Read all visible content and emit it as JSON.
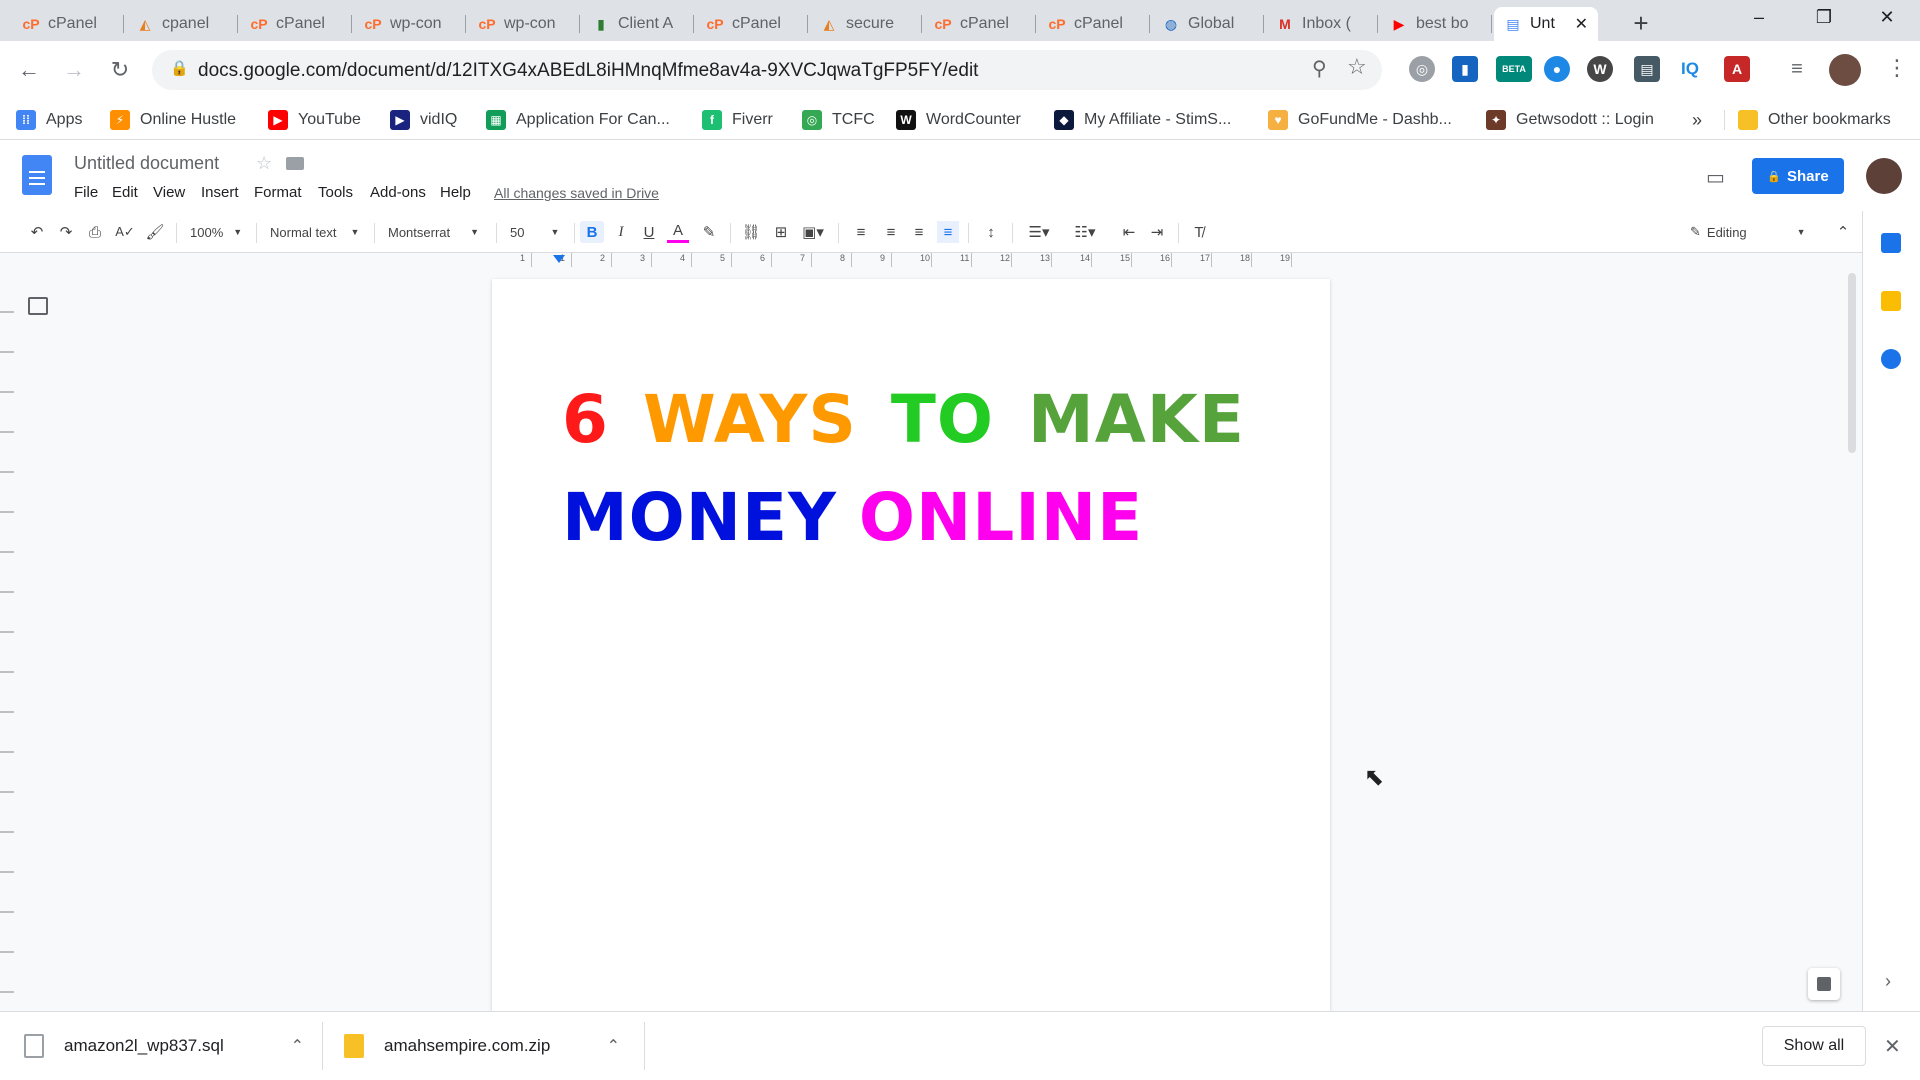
{
  "browser": {
    "tabs": [
      {
        "label": "cPanel",
        "icon": "cpanel-icon"
      },
      {
        "label": "cpanel",
        "icon": "hosting-icon"
      },
      {
        "label": "cPanel",
        "icon": "cpanel-icon"
      },
      {
        "label": "wp-con",
        "icon": "cpanel-icon"
      },
      {
        "label": "wp-con",
        "icon": "cpanel-icon"
      },
      {
        "label": "Client A",
        "icon": "chart-icon"
      },
      {
        "label": "cPanel",
        "icon": "cpanel-icon"
      },
      {
        "label": "secure",
        "icon": "hosting-icon"
      },
      {
        "label": "cPanel",
        "icon": "cpanel-icon"
      },
      {
        "label": "cPanel",
        "icon": "cpanel-icon"
      },
      {
        "label": "Global",
        "icon": "globe-icon"
      },
      {
        "label": "Inbox (",
        "icon": "gmail-icon"
      },
      {
        "label": "best bo",
        "icon": "youtube-icon"
      },
      {
        "label": "Unt",
        "icon": "docs-icon",
        "active": true
      }
    ],
    "url": "docs.google.com/document/d/12ITXG4xABEdL8iHMnqMfme8av4a-9XVCJqwaTgFP5FY/edit",
    "beta_badge": "BETA",
    "iq_badge": "IQ"
  },
  "bookmarks": [
    {
      "label": "Apps",
      "icon": "apps-grid-icon",
      "color": "#4285f4"
    },
    {
      "label": "Online Hustle",
      "icon": "hustle-icon",
      "color": "#ff8f00"
    },
    {
      "label": "YouTube",
      "icon": "youtube-icon",
      "color": "#ff0000"
    },
    {
      "label": "vidIQ",
      "icon": "vidiq-icon",
      "color": "#1a237e"
    },
    {
      "label": "Application For Can...",
      "icon": "sheets-icon",
      "color": "#0f9d58"
    },
    {
      "label": "Fiverr",
      "icon": "fiverr-icon",
      "color": "#1dbf73"
    },
    {
      "label": "TCFC",
      "icon": "tcfc-icon",
      "color": "#34a853"
    },
    {
      "label": "WordCounter",
      "icon": "wordcounter-icon",
      "color": "#111111"
    },
    {
      "label": "My Affiliate - StimS...",
      "icon": "affiliate-icon",
      "color": "#0b1a3c"
    },
    {
      "label": "GoFundMe - Dashb...",
      "icon": "gofundme-icon",
      "color": "#f5b041"
    },
    {
      "label": "Getwsodott :: Login",
      "icon": "login-icon",
      "color": "#6d3a2a"
    }
  ],
  "bookmarks_overflow": "»",
  "other_bookmarks": "Other bookmarks",
  "docs": {
    "title": "Untitled document",
    "menu": [
      "File",
      "Edit",
      "View",
      "Insert",
      "Format",
      "Tools",
      "Add-ons",
      "Help"
    ],
    "save_status": "All changes saved in Drive",
    "share_label": "Share",
    "zoom": "100%",
    "style": "Normal text",
    "font": "Montserrat",
    "font_size": "50",
    "mode": "Editing",
    "ruler_numbers": [
      "1",
      "1",
      "2",
      "3",
      "4",
      "5",
      "6",
      "7",
      "8",
      "9",
      "10",
      "11",
      "12",
      "13",
      "14",
      "15",
      "16",
      "17",
      "18",
      "19"
    ]
  },
  "document": {
    "line1": [
      {
        "text": "6",
        "color": "#ff1a1a"
      },
      {
        "text": "WAYS",
        "color": "#ff9900"
      },
      {
        "text": "TO",
        "color": "#22cc22"
      },
      {
        "text": "MAKE",
        "color": "#56a33c"
      }
    ],
    "line2": [
      {
        "text": "MONEY",
        "color": "#0011dd"
      },
      {
        "text": "ONLINE",
        "color": "#ff00ee"
      }
    ]
  },
  "downloads": {
    "items": [
      {
        "name": "amazon2l_wp837.sql",
        "icon": "file-icon"
      },
      {
        "name": "amahsempire.com.zip",
        "icon": "zip-icon"
      }
    ],
    "show_all": "Show all"
  }
}
